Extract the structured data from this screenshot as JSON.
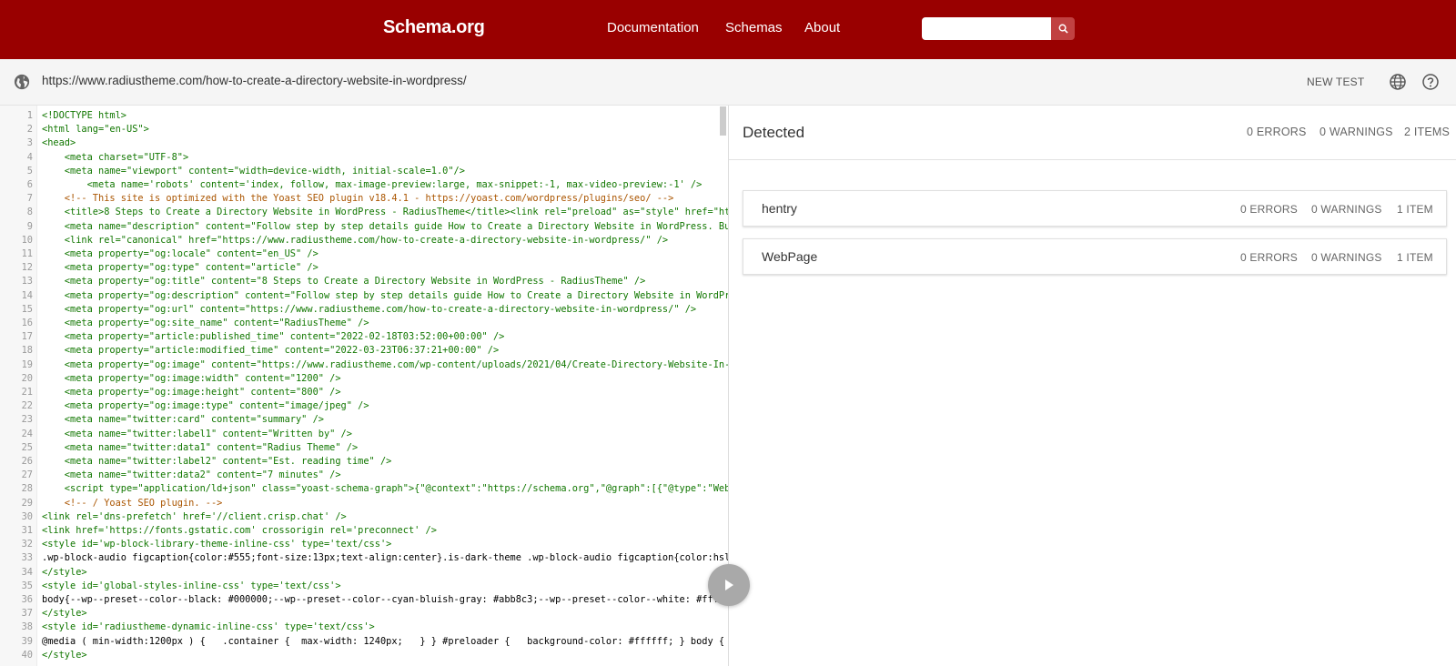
{
  "header": {
    "brand": "Schema.org",
    "nav": [
      "Documentation",
      "Schemas",
      "About"
    ],
    "search_placeholder": ""
  },
  "urlbar": {
    "url": "https://www.radiustheme.com/how-to-create-a-directory-website-in-wordpress/",
    "new_test": "NEW TEST"
  },
  "code_lines": [
    "<!DOCTYPE html>",
    "<html lang=\"en-US\">",
    "<head>",
    "    <meta charset=\"UTF-8\">",
    "    <meta name=\"viewport\" content=\"width=device-width, initial-scale=1.0\"/>",
    "        <meta name='robots' content='index, follow, max-image-preview:large, max-snippet:-1, max-video-preview:-1' />",
    "    <!-- This site is optimized with the Yoast SEO plugin v18.4.1 - https://yoast.com/wordpress/plugins/seo/ -->",
    "    <title>8 Steps to Create a Directory Website in WordPress - RadiusTheme</title><link rel=\"preload\" as=\"style\" href=\"https://",
    "    <meta name=\"description\" content=\"Follow step by step details guide How to Create a Directory Website in WordPress. Build p",
    "    <link rel=\"canonical\" href=\"https://www.radiustheme.com/how-to-create-a-directory-website-in-wordpress/\" />",
    "    <meta property=\"og:locale\" content=\"en_US\" />",
    "    <meta property=\"og:type\" content=\"article\" />",
    "    <meta property=\"og:title\" content=\"8 Steps to Create a Directory Website in WordPress - RadiusTheme\" />",
    "    <meta property=\"og:description\" content=\"Follow step by step details guide How to Create a Directory Website in WordPress.",
    "    <meta property=\"og:url\" content=\"https://www.radiustheme.com/how-to-create-a-directory-website-in-wordpress/\" />",
    "    <meta property=\"og:site_name\" content=\"RadiusTheme\" />",
    "    <meta property=\"article:published_time\" content=\"2022-02-18T03:52:00+00:00\" />",
    "    <meta property=\"article:modified_time\" content=\"2022-03-23T06:37:21+00:00\" />",
    "    <meta property=\"og:image\" content=\"https://www.radiustheme.com/wp-content/uploads/2021/04/Create-Directory-Website-In-WordP",
    "    <meta property=\"og:image:width\" content=\"1200\" />",
    "    <meta property=\"og:image:height\" content=\"800\" />",
    "    <meta property=\"og:image:type\" content=\"image/jpeg\" />",
    "    <meta name=\"twitter:card\" content=\"summary\" />",
    "    <meta name=\"twitter:label1\" content=\"Written by\" />",
    "    <meta name=\"twitter:data1\" content=\"Radius Theme\" />",
    "    <meta name=\"twitter:label2\" content=\"Est. reading time\" />",
    "    <meta name=\"twitter:data2\" content=\"7 minutes\" />",
    "    <script type=\"application/ld+json\" class=\"yoast-schema-graph\">{\"@context\":\"https://schema.org\",\"@graph\":[{\"@type\":\"WebSite\"",
    "    <!-- / Yoast SEO plugin. -->",
    "<link rel='dns-prefetch' href='//client.crisp.chat' />",
    "<link href='https://fonts.gstatic.com' crossorigin rel='preconnect' />",
    "<style id='wp-block-library-theme-inline-css' type='text/css'>",
    ".wp-block-audio figcaption{color:#555;font-size:13px;text-align:center}.is-dark-theme .wp-block-audio figcaption{color:hsla(0,0",
    "</style>",
    "<style id='global-styles-inline-css' type='text/css'>",
    "body{--wp--preset--color--black: #000000;--wp--preset--color--cyan-bluish-gray: #abb8c3;--wp--preset--color--white: #ffffff;",
    "</style>",
    "<style id='radiustheme-dynamic-inline-css' type='text/css'>",
    "@media ( min-width:1200px ) {   .container {  max-width: 1240px;   } } #preloader {   background-color: #ffffff; } body {   col",
    "</style>"
  ],
  "results": {
    "title": "Detected",
    "errors": "0 ERRORS",
    "warnings": "0 WARNINGS",
    "items": "2 ITEMS",
    "entries": [
      {
        "name": "hentry",
        "errors": "0 ERRORS",
        "warnings": "0 WARNINGS",
        "items": "1 ITEM"
      },
      {
        "name": "WebPage",
        "errors": "0 ERRORS",
        "warnings": "0 WARNINGS",
        "items": "1 ITEM"
      }
    ]
  },
  "colors": {
    "brand_red": "#990000",
    "search_button": "#c14141"
  },
  "icons": [
    "search-icon",
    "globe-icon",
    "language-icon",
    "help-icon",
    "play-icon"
  ]
}
